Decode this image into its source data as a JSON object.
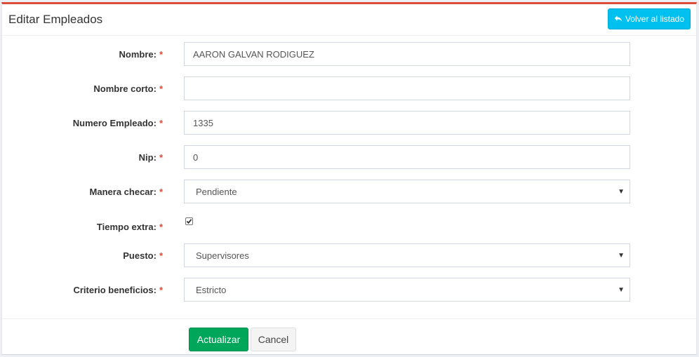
{
  "header": {
    "title": "Editar Empleados",
    "back_button": "Volver al listado",
    "back_icon": "reply-icon"
  },
  "required_marker": "*",
  "form": {
    "nombre": {
      "label": "Nombre:",
      "value": "AARON GALVAN RODIGUEZ"
    },
    "nombre_corto": {
      "label": "Nombre corto:",
      "value": ""
    },
    "numero_empleado": {
      "label": "Numero Empleado:",
      "value": "1335"
    },
    "nip": {
      "label": "Nip:",
      "value": "0"
    },
    "manera_checar": {
      "label": "Manera checar:",
      "value": "Pendiente"
    },
    "tiempo_extra": {
      "label": "Tiempo extra:",
      "checked": true
    },
    "puesto": {
      "label": "Puesto:",
      "value": "Supervisores"
    },
    "criterio_beneficios": {
      "label": "Criterio beneficios:",
      "value": "Estricto"
    }
  },
  "footer": {
    "update_button": "Actualizar",
    "cancel_button": "Cancel"
  },
  "colors": {
    "accent_top": "#dd4b39",
    "info_button": "#00c0ef",
    "success_button": "#00a65a",
    "required": "#dd4b39"
  }
}
